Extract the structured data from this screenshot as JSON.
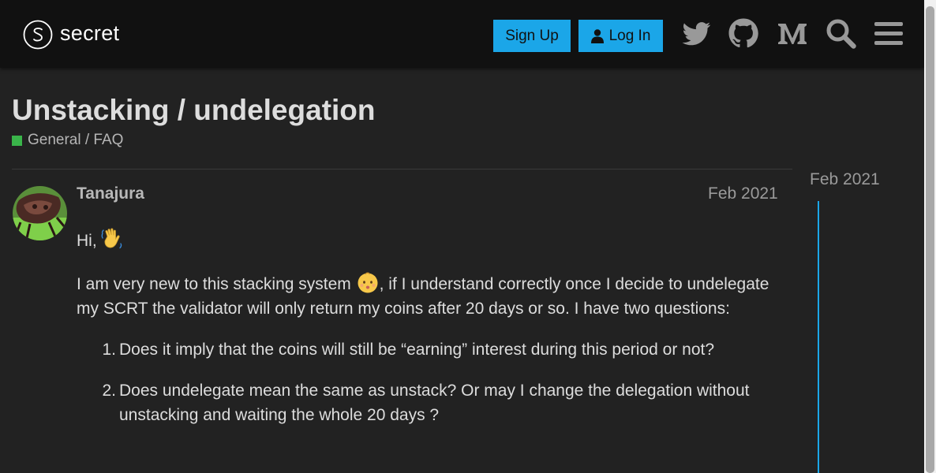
{
  "header": {
    "logo_text": "secret",
    "signup_label": "Sign Up",
    "login_label": "Log In",
    "icons": [
      "twitter-icon",
      "github-icon",
      "medium-icon",
      "search-icon",
      "hamburger-menu-icon"
    ]
  },
  "topic": {
    "title": "Unstacking / undelegation",
    "category": "General / FAQ",
    "category_color": "#3ab54a"
  },
  "post": {
    "username": "Tanajura",
    "date": "Feb 2021",
    "greeting": "Hi,",
    "para_before_emoji": "I am very new to this stacking system ",
    "para_after_emoji": ", if I understand correctly once I decide to undelegate my SCRT the validator will only return my coins after 20 days or so. I have two questions:",
    "questions": [
      {
        "num": "1.",
        "text": "Does it imply that the coins will still be “earning” interest during this period or not?"
      },
      {
        "num": "2.",
        "text": "Does undelegate mean the same as unstack? Or may I change the delegation without unstacking and waiting the whole 20 days ?"
      }
    ]
  },
  "timeline": {
    "date": "Feb 2021"
  },
  "colors": {
    "accent": "#1ba6e8",
    "header_bg": "#111111",
    "page_bg": "#222222"
  }
}
